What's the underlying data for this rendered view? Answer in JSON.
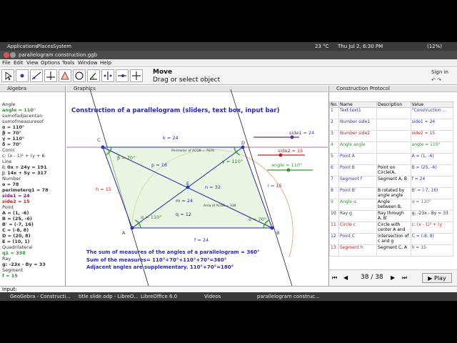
{
  "system": {
    "apps": "Applications",
    "places": "Places",
    "system": "System",
    "temp": "23 °C",
    "clock": "Thu Jul 2, 6:30 PM",
    "battery": "(12%)"
  },
  "window": {
    "title": "parallelogram construction.ggb"
  },
  "menu": [
    "File",
    "Edit",
    "View",
    "Options",
    "Tools",
    "Window",
    "Help"
  ],
  "mode": {
    "name": "Move",
    "hint": "Drag or select object"
  },
  "signin": "Sign in",
  "algebra": {
    "header": "Algebra",
    "rows": [
      {
        "t": "Angle",
        "c": "#333"
      },
      {
        "t": "angle = 110°",
        "c": "#2a9a2a"
      },
      {
        "t": "sumofadjacentan",
        "c": "#333"
      },
      {
        "t": "sumofmeasuresof",
        "c": "#333"
      },
      {
        "t": "α = 110°",
        "c": "#333"
      },
      {
        "t": "β = 70°",
        "c": "#333"
      },
      {
        "t": "γ = 110°",
        "c": "#333"
      },
      {
        "t": "δ = 70°",
        "c": "#333"
      },
      {
        "t": "Conic",
        "c": "#333"
      },
      {
        "t": "c: (x - 1)² + (y + 6",
        "c": "#333"
      },
      {
        "t": "Line",
        "c": "#333"
      },
      {
        "t": "i: 0x + 24y = 191",
        "c": "#333"
      },
      {
        "t": "j: 14x + 5y = 317",
        "c": "#333"
      },
      {
        "t": "Number",
        "c": "#333"
      },
      {
        "t": "e = 78",
        "c": "#333"
      },
      {
        "t": "perimeterq1 = 78",
        "c": "#333"
      },
      {
        "t": "side1 = 24",
        "c": "#7a1a8a"
      },
      {
        "t": "side2 = 15",
        "c": "#c0201a"
      },
      {
        "t": "Point",
        "c": "#333"
      },
      {
        "t": "A = (1, -6)",
        "c": "#333"
      },
      {
        "t": "B = (25, -6)",
        "c": "#333"
      },
      {
        "t": "B' = (-7, 16)",
        "c": "#333"
      },
      {
        "t": "C = (-8, 8)",
        "c": "#333"
      },
      {
        "t": "D = (20, 8)",
        "c": "#333"
      },
      {
        "t": "E = (10, 1)",
        "c": "#333"
      },
      {
        "t": "Quadrilateral",
        "c": "#333"
      },
      {
        "t": "q1 = 338",
        "c": "#2a9a2a"
      },
      {
        "t": "Ray",
        "c": "#333"
      },
      {
        "t": "g: -23x - By = 33",
        "c": "#333"
      },
      {
        "t": "Segment",
        "c": "#333"
      },
      {
        "t": "f = 15",
        "c": "#2a9a2a"
      }
    ]
  },
  "graphics": {
    "header": "Graphics",
    "title": "Construction of a parallelogram (sliders, text box, input bar)",
    "perimeter_label": "Perimeter of ACDB = 7676",
    "area_label": "Area of ACDB = 338",
    "sliders": [
      {
        "label": "side1 = 24",
        "color": "#6a2a8a"
      },
      {
        "label": "side2 = 15",
        "color": "#c0201a"
      },
      {
        "label": "angle = 110°",
        "color": "#2a9a2a"
      }
    ],
    "labels": {
      "k": "k = 24",
      "h": "h = 15",
      "l": "l = 15",
      "f": "f = 24",
      "p": "p = 16",
      "m": "m = 24",
      "n": "n = 32",
      "q": "q = 12",
      "alpha": "α = 110°",
      "beta": "β = 70°",
      "gamma": "γ = 110°",
      "delta": "δ = 70°",
      "A": "A",
      "B": "B",
      "C": "C",
      "D": "D",
      "E": "E"
    },
    "notes": [
      "The sum of measures of the angles of a parallelogram = 360°",
      "Sum of the measures= 110°+70°+110°+70°=360°",
      "Adjacent angles are supplementary. 110°+70°=180°"
    ]
  },
  "protocol": {
    "header": "Construction Protocol",
    "columns": [
      "No.",
      "Name",
      "Description",
      "Value"
    ],
    "rows": [
      {
        "no": "1",
        "name": "Text text1",
        "desc": "",
        "val": "\"Construction ...",
        "c": "#2a3ab0"
      },
      {
        "no": "2",
        "name": "Number side1",
        "desc": "",
        "val": "side1 = 24",
        "c": "#2a3ab0"
      },
      {
        "no": "3",
        "name": "Number side2",
        "desc": "",
        "val": "side2 = 15",
        "c": "#c0201a"
      },
      {
        "no": "4",
        "name": "Angle angle",
        "desc": "",
        "val": "angle = 110°",
        "c": "#2a9a2a"
      },
      {
        "no": "5",
        "name": "Point A",
        "desc": "",
        "val": "A = (1, -6)",
        "c": "#2a3ab0"
      },
      {
        "no": "6",
        "name": "Point B",
        "desc": "Point on Circle(A,",
        "val": "B = (25, -6)",
        "c": "#2a3ab0"
      },
      {
        "no": "7",
        "name": "Segment f",
        "desc": "Segment A, B",
        "val": "f = 24",
        "c": "#2a3ab0"
      },
      {
        "no": "8",
        "name": "Point B'",
        "desc": "B rotated by angle angle",
        "val": "B' = (-7, 16)",
        "c": "#2a3ab0"
      },
      {
        "no": "9",
        "name": "Angle α",
        "desc": "Angle between B,",
        "val": "α = 110°",
        "c": "#2a9a2a"
      },
      {
        "no": "10",
        "name": "Ray g",
        "desc": "Ray through A, B'",
        "val": "g: -23x - By = 33",
        "c": "#333"
      },
      {
        "no": "11",
        "name": "Circle c",
        "desc": "Circle with center A and",
        "val": "c: (x - 1)² + (y",
        "c": "#c0201a"
      },
      {
        "no": "12",
        "name": "Point C",
        "desc": "Intersection of c and g",
        "val": "C = (-8, 8)",
        "c": "#2a3ab0"
      },
      {
        "no": "13",
        "name": "Segment h",
        "desc": "Segment C, A",
        "val": "h = 15",
        "c": "#c0201a"
      }
    ],
    "nav": "38 / 38",
    "play": "Play"
  },
  "input_label": "Input:",
  "taskbar": [
    "GeoGebra - Constructi...",
    "title slide.odp - LibreO...",
    "LibreOffice 6.0",
    "Videos",
    "parallelogram construc..."
  ]
}
